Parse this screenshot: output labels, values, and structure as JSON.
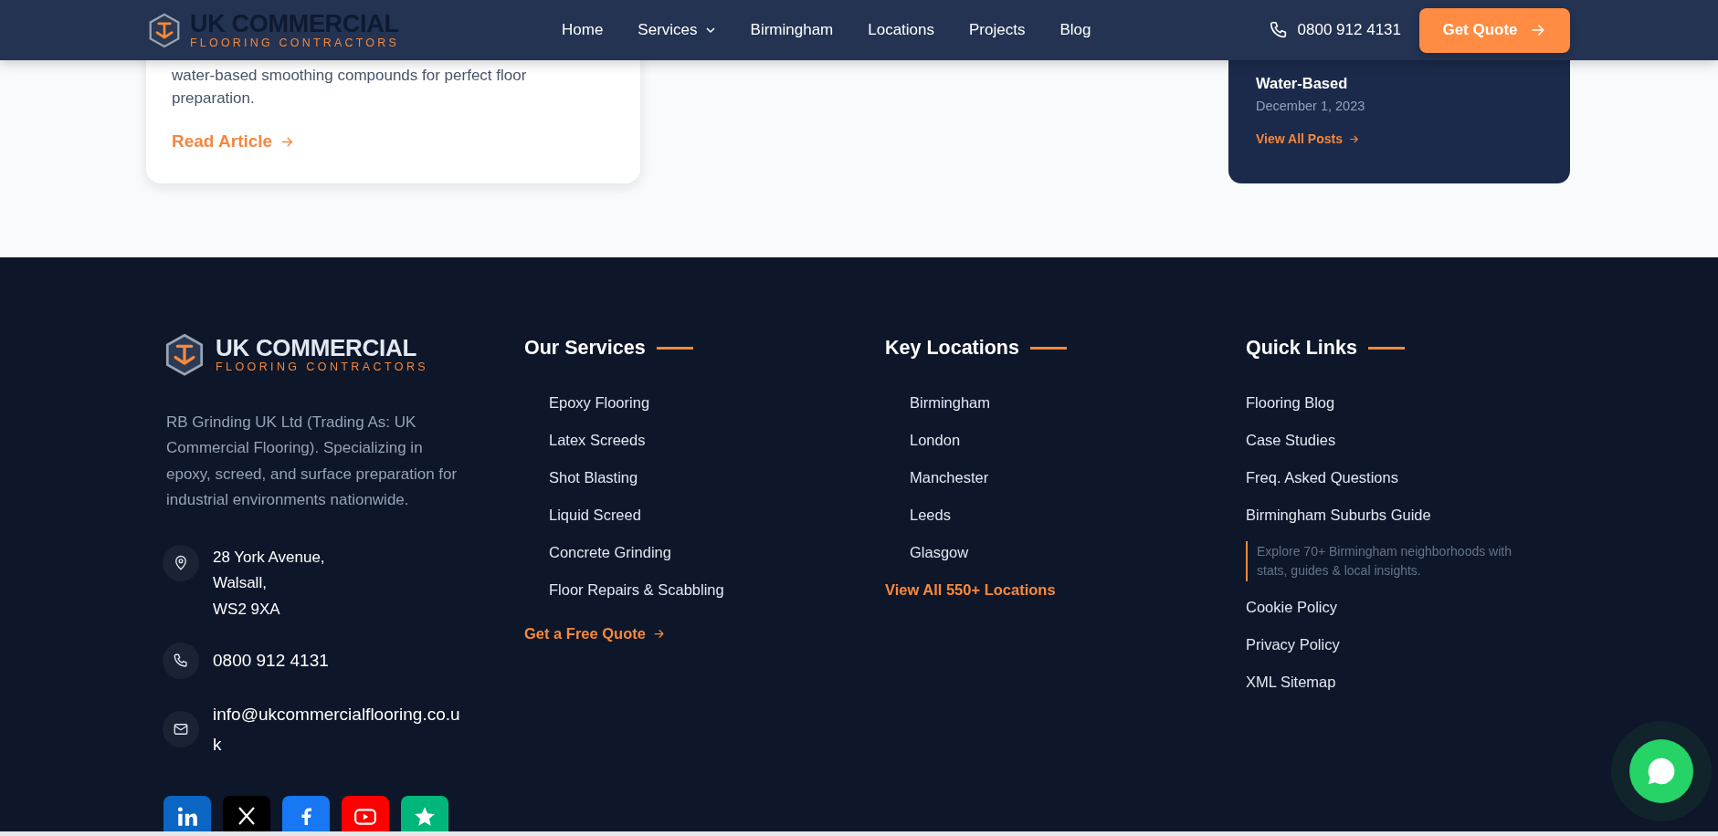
{
  "header": {
    "brand": {
      "name": "UK COMMERCIAL",
      "tagline": "FLOORING CONTRACTORS"
    },
    "nav": [
      {
        "label": "Home",
        "dropdown": false
      },
      {
        "label": "Services",
        "dropdown": true
      },
      {
        "label": "Birmingham",
        "dropdown": false
      },
      {
        "label": "Locations",
        "dropdown": false
      },
      {
        "label": "Projects",
        "dropdown": false
      },
      {
        "label": "Blog",
        "dropdown": false
      }
    ],
    "phone": "0800 912 4131",
    "cta": "Get Quote"
  },
  "article_card": {
    "excerpt": "water-based smoothing compounds for perfect floor preparation.",
    "link": "Read Article"
  },
  "blog_sidebar": {
    "post_title": "Water-Based",
    "date": "December 1, 2023",
    "link": "View All Posts"
  },
  "footer": {
    "brand": {
      "name": "UK COMMERCIAL",
      "tagline": "FLOORING CONTRACTORS"
    },
    "about": "RB Grinding UK Ltd (Trading As: UK Commercial Flooring). Specializing in epoxy, screed, and surface preparation for industrial environments nationwide.",
    "contact": [
      {
        "kind": "address",
        "lines": [
          "28 York Avenue,",
          "Walsall,",
          "WS2 9XA"
        ]
      },
      {
        "kind": "phone",
        "text": "0800 912 4131"
      },
      {
        "kind": "email",
        "text": "info@ukcommercialflooring.co.uk"
      }
    ],
    "social": [
      {
        "kind": "linkedin",
        "color": "#0a66c2"
      },
      {
        "kind": "x",
        "color": "#000000"
      },
      {
        "kind": "facebook",
        "color": "#1877f2"
      },
      {
        "kind": "youtube",
        "color": "#ff0000"
      },
      {
        "kind": "star",
        "color": "#00b67a"
      }
    ],
    "services": {
      "title": "Our Services",
      "items": [
        "Epoxy Flooring",
        "Latex Screeds",
        "Shot Blasting",
        "Liquid Screed",
        "Concrete Grinding",
        "Floor Repairs & Scabbling"
      ],
      "link": "Get a Free Quote"
    },
    "locations": {
      "title": "Key Locations",
      "items": [
        "Birmingham",
        "London",
        "Manchester",
        "Leeds",
        "Glasgow"
      ],
      "link": "View All 550+ Locations"
    },
    "quick_links": {
      "title": "Quick Links",
      "items": [
        {
          "label": "Flooring Blog"
        },
        {
          "label": "Case Studies"
        },
        {
          "label": "Freq. Asked Questions"
        },
        {
          "label": "Birmingham Suburbs Guide",
          "note": "Explore 70+ Birmingham neighborhoods with stats, guides & local insights."
        },
        {
          "label": "Cookie Policy"
        },
        {
          "label": "Privacy Policy"
        },
        {
          "label": "XML Sitemap"
        }
      ]
    }
  },
  "chat_button": {
    "kind": "chat"
  }
}
